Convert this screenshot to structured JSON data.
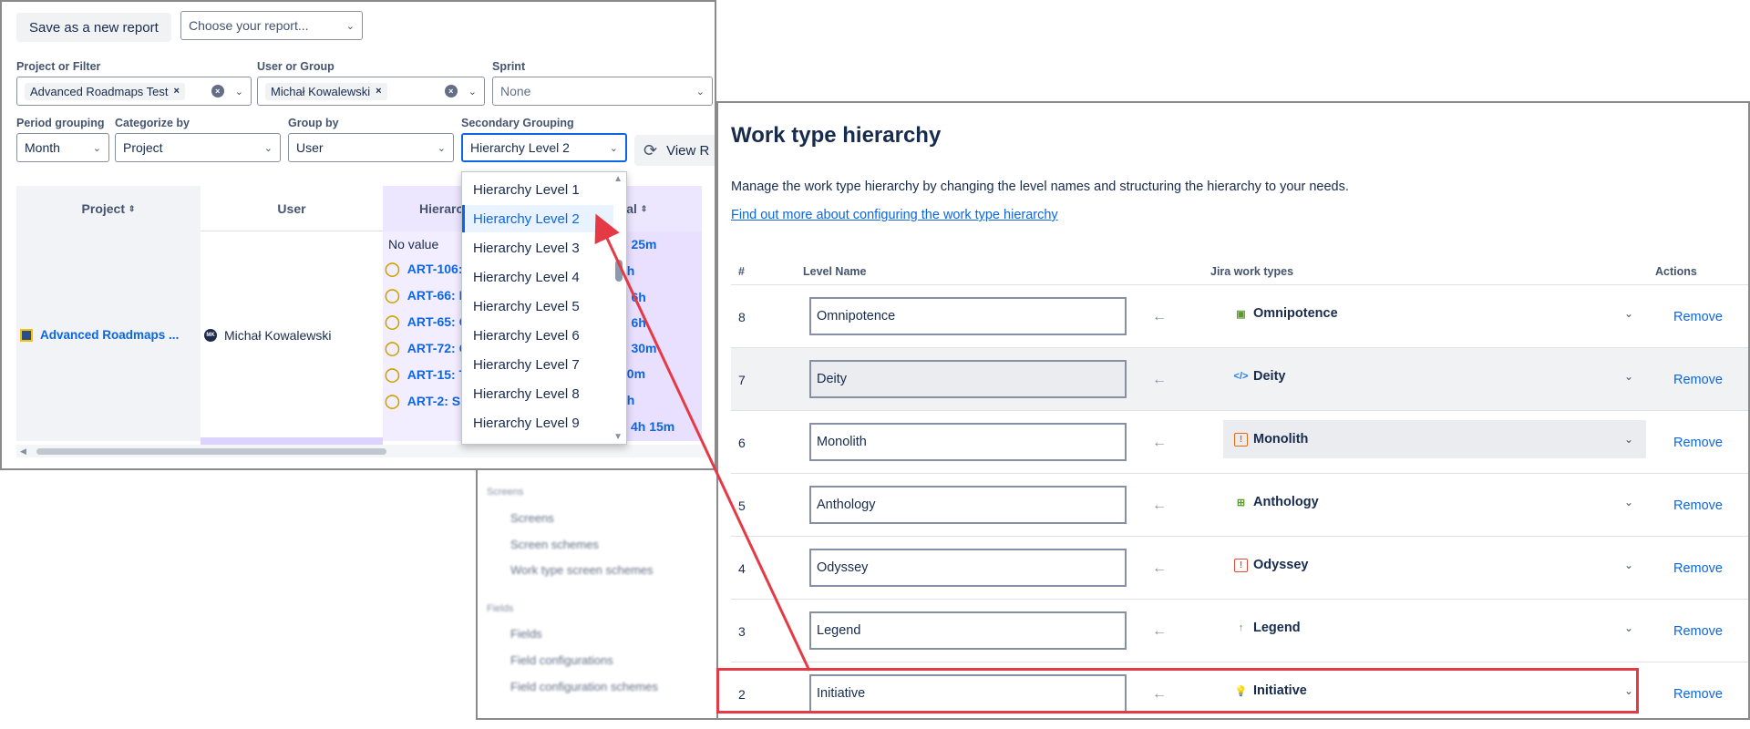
{
  "report": {
    "save_button": "Save as a new report",
    "choose_report_placeholder": "Choose your report...",
    "labels": {
      "project_filter": "Project or Filter",
      "user_group": "User or Group",
      "sprint": "Sprint",
      "period_grouping": "Period grouping",
      "categorize_by": "Categorize by",
      "group_by": "Group by",
      "secondary_grouping": "Secondary Grouping"
    },
    "project_chip": "Advanced Roadmaps Test",
    "user_chip": "Michał Kowalewski",
    "sprint_value": "None",
    "period_value": "Month",
    "categorize_value": "Project",
    "group_value": "User",
    "secondary_value": "Hierarchy Level 2",
    "view_button": "View R",
    "table": {
      "headers": {
        "project": "Project",
        "user": "User",
        "hierarchy": "Hierarc",
        "total": "otal"
      },
      "project_name": "Advanced Roadmaps ...",
      "user_name": "Michał Kowalewski",
      "avatar_initials": "MK",
      "no_value": "No value",
      "issues": [
        "ART-106: ",
        "ART-66: F",
        "ART-65: C",
        "ART-72: C",
        "ART-15: T",
        "ART-2: Sh"
      ],
      "totals": [
        "h 25m",
        "2h",
        "d 6h",
        "d 6h",
        "h 30m",
        "20m",
        "2h",
        "4h 15m"
      ]
    },
    "dropdown_options": [
      "Hierarchy Level 1",
      "Hierarchy Level 2",
      "Hierarchy Level 3",
      "Hierarchy Level 4",
      "Hierarchy Level 5",
      "Hierarchy Level 6",
      "Hierarchy Level 7",
      "Hierarchy Level 8",
      "Hierarchy Level 9"
    ]
  },
  "sidebar_bg": {
    "screens_header": "Screens",
    "screens": [
      "Screens",
      "Screen schemes",
      "Work type screen schemes"
    ],
    "fields_header": "Fields",
    "fields": [
      "Fields",
      "Field configurations",
      "Field configuration schemes"
    ]
  },
  "hierarchy": {
    "title": "Work type hierarchy",
    "description": "Manage the work type hierarchy by changing the level names and structuring the hierarchy to your needs.",
    "link": "Find out more about configuring the work type hierarchy",
    "columns": {
      "num": "#",
      "level": "Level Name",
      "types": "Jira work types",
      "actions": "Actions"
    },
    "remove_label": "Remove",
    "rows": [
      {
        "num": "8",
        "level": "Omnipotence",
        "type": "Omnipotence",
        "icon": "omnipotence-icon",
        "color": "#5b9a2b"
      },
      {
        "num": "7",
        "level": "Deity",
        "type": "Deity",
        "icon": "code-icon",
        "color": "#1d7afc"
      },
      {
        "num": "6",
        "level": "Monolith",
        "type": "Monolith",
        "icon": "alert-icon",
        "color": "#e56910"
      },
      {
        "num": "5",
        "level": "Anthology",
        "type": "Anthology",
        "icon": "plus-square-icon",
        "color": "#5b9a2b"
      },
      {
        "num": "4",
        "level": "Odyssey",
        "type": "Odyssey",
        "icon": "alert-icon",
        "color": "#e34935"
      },
      {
        "num": "3",
        "level": "Legend",
        "type": "Legend",
        "icon": "arrow-up-icon",
        "color": "#5b9a2b"
      },
      {
        "num": "2",
        "level": "Initiative",
        "type": "Initiative",
        "icon": "lightbulb-icon",
        "color": "#c9a500"
      }
    ]
  },
  "colors": {
    "accent": "#0c66e4",
    "highlight": "#e63946",
    "purple": "#ede6ff"
  }
}
